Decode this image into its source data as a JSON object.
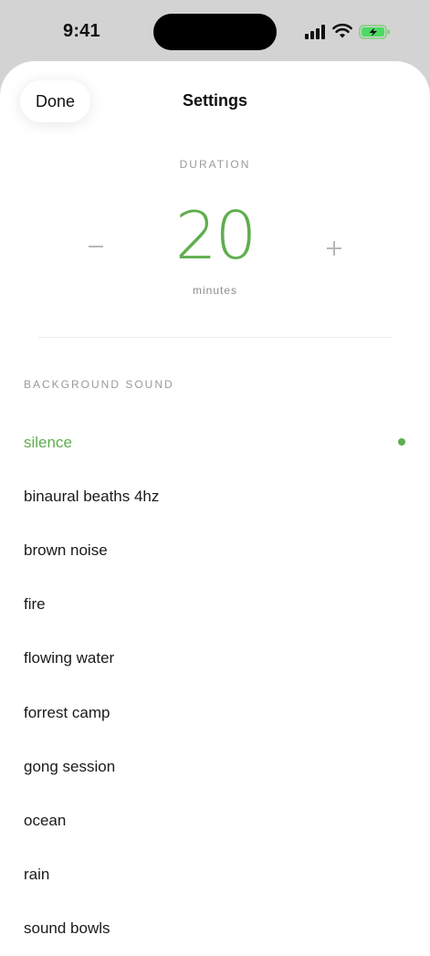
{
  "status_bar": {
    "time": "9:41",
    "battery_state": "charging",
    "battery_color": "#4cd964"
  },
  "header": {
    "done_label": "Done",
    "title": "Settings"
  },
  "duration": {
    "section_label": "DURATION",
    "value": "20",
    "unit": "minutes",
    "decrement_icon": "minus-icon",
    "increment_icon": "plus-icon"
  },
  "background_sound": {
    "section_label": "BACKGROUND SOUND",
    "selected_index": 0,
    "items": [
      {
        "label": "silence"
      },
      {
        "label": "binaural beaths 4hz"
      },
      {
        "label": "brown noise"
      },
      {
        "label": "fire"
      },
      {
        "label": "flowing water"
      },
      {
        "label": "forrest camp"
      },
      {
        "label": "gong session"
      },
      {
        "label": "ocean"
      },
      {
        "label": "rain"
      },
      {
        "label": "sound bowls"
      }
    ]
  },
  "colors": {
    "accent": "#5fae4e",
    "sheet_background": "#ffffff",
    "backdrop": "#d3d3d3",
    "muted_text": "#9a9a9a"
  }
}
